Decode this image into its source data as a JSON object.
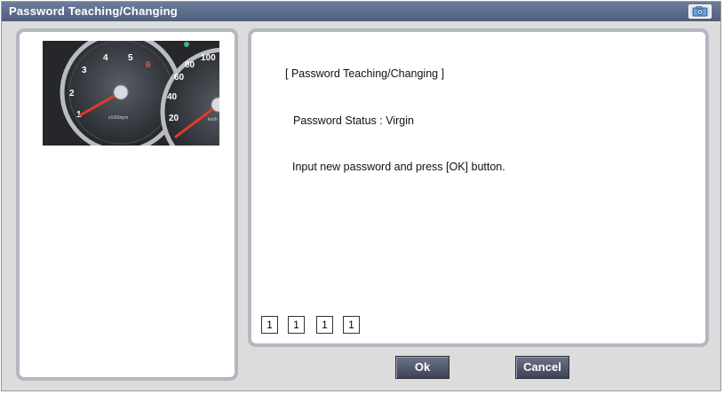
{
  "window": {
    "title": "Password Teaching/Changing",
    "title_icon": "camera-icon"
  },
  "content": {
    "heading": "[ Password Teaching/Changing ]",
    "status_line": "Password Status : Virgin",
    "instruction": "Input new password and press [OK] button."
  },
  "password_fields": [
    "1",
    "1",
    "1",
    "1"
  ],
  "buttons": {
    "ok_label": "Ok",
    "cancel_label": "Cancel"
  },
  "gauge": {
    "tach_numbers": [
      "1",
      "2",
      "3",
      "4",
      "5",
      "6"
    ],
    "tach_unit": "x1000rpm",
    "speed_numbers": [
      "20",
      "40",
      "60",
      "80",
      "100"
    ],
    "speed_unit": "km/h"
  },
  "colors": {
    "titlebar": "#5a6888",
    "panel_border": "#b4b7c0",
    "button": "#4b5165",
    "needle": "#e03a2a"
  }
}
